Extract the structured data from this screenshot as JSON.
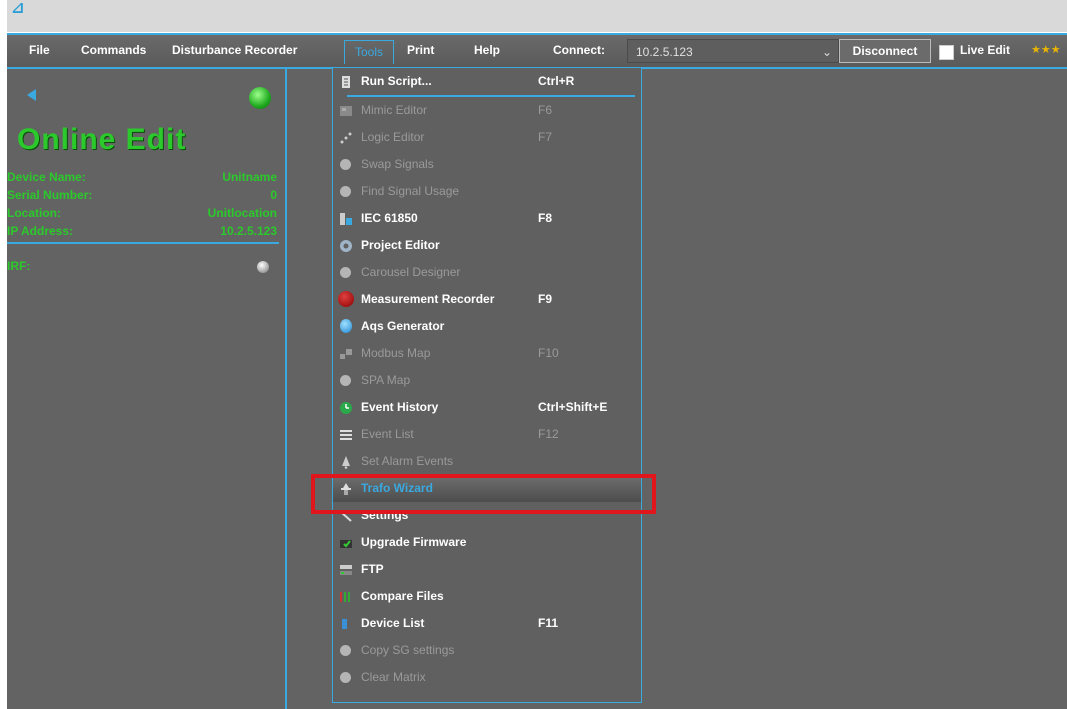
{
  "titlebar": {
    "logo": "⊿"
  },
  "menubar": {
    "items": [
      "File",
      "Commands",
      "Disturbance Recorder",
      "Tools",
      "Print",
      "Help"
    ],
    "connect_label": "Connect:",
    "connect_value": "10.2.5.123",
    "disconnect_label": "Disconnect",
    "live_edit_label": "Live Edit",
    "stars": "★★★"
  },
  "device_panel": {
    "title": "Online Edit",
    "rows": [
      {
        "key": "Device Name:",
        "value": "Unitname"
      },
      {
        "key": "Serial Number:",
        "value": "0"
      },
      {
        "key": "Location:",
        "value": "Unitlocation"
      },
      {
        "key": "IP Address:",
        "value": "10.2.5.123"
      }
    ],
    "irf_label": "IRF:"
  },
  "tools_menu": {
    "items": [
      {
        "label": "Run Script...",
        "shortcut": "Ctrl+R",
        "enabled": true,
        "icon": "script-icon"
      },
      {
        "label": "Mimic Editor",
        "shortcut": "F6",
        "enabled": false,
        "icon": "mimic-icon"
      },
      {
        "label": "Logic Editor",
        "shortcut": "F7",
        "enabled": false,
        "icon": "logic-icon"
      },
      {
        "label": "Swap Signals",
        "shortcut": "",
        "enabled": false,
        "icon": "dot-icon"
      },
      {
        "label": "Find Signal Usage",
        "shortcut": "",
        "enabled": false,
        "icon": "dot-icon"
      },
      {
        "label": "IEC 61850",
        "shortcut": "F8",
        "enabled": true,
        "icon": "iec-icon"
      },
      {
        "label": "Project Editor",
        "shortcut": "",
        "enabled": true,
        "icon": "gear-icon"
      },
      {
        "label": "Carousel Designer",
        "shortcut": "",
        "enabled": false,
        "icon": "dot-icon"
      },
      {
        "label": "Measurement Recorder",
        "shortcut": "F9",
        "enabled": true,
        "icon": "record-icon"
      },
      {
        "label": "Aqs Generator",
        "shortcut": "",
        "enabled": true,
        "icon": "drop-icon"
      },
      {
        "label": "Modbus Map",
        "shortcut": "F10",
        "enabled": false,
        "icon": "modbus-icon"
      },
      {
        "label": "SPA Map",
        "shortcut": "",
        "enabled": false,
        "icon": "dot-icon"
      },
      {
        "label": "Event History",
        "shortcut": "Ctrl+Shift+E",
        "enabled": true,
        "icon": "history-icon"
      },
      {
        "label": "Event List",
        "shortcut": "F12",
        "enabled": false,
        "icon": "list-icon"
      },
      {
        "label": "Set Alarm Events",
        "shortcut": "",
        "enabled": false,
        "icon": "bell-icon"
      },
      {
        "label": "Trafo Wizard",
        "shortcut": "",
        "enabled": true,
        "icon": "wizard-icon",
        "highlighted": true
      },
      {
        "label": "Settings",
        "shortcut": "",
        "enabled": true,
        "icon": "wrench-icon"
      },
      {
        "label": "Upgrade Firmware",
        "shortcut": "",
        "enabled": true,
        "icon": "firmware-icon"
      },
      {
        "label": "FTP",
        "shortcut": "",
        "enabled": true,
        "icon": "ftp-icon"
      },
      {
        "label": "Compare Files",
        "shortcut": "",
        "enabled": true,
        "icon": "compare-icon"
      },
      {
        "label": "Device List",
        "shortcut": "F11",
        "enabled": true,
        "icon": "device-icon"
      },
      {
        "label": "Copy SG settings",
        "shortcut": "",
        "enabled": false,
        "icon": "dot-icon"
      },
      {
        "label": "Clear Matrix",
        "shortcut": "",
        "enabled": false,
        "icon": "dot-icon"
      }
    ]
  },
  "colors": {
    "accent": "#3aa9e0",
    "online_green": "#2bc92b",
    "highlight_red": "#e0161c",
    "panel_bg": "#636363"
  }
}
